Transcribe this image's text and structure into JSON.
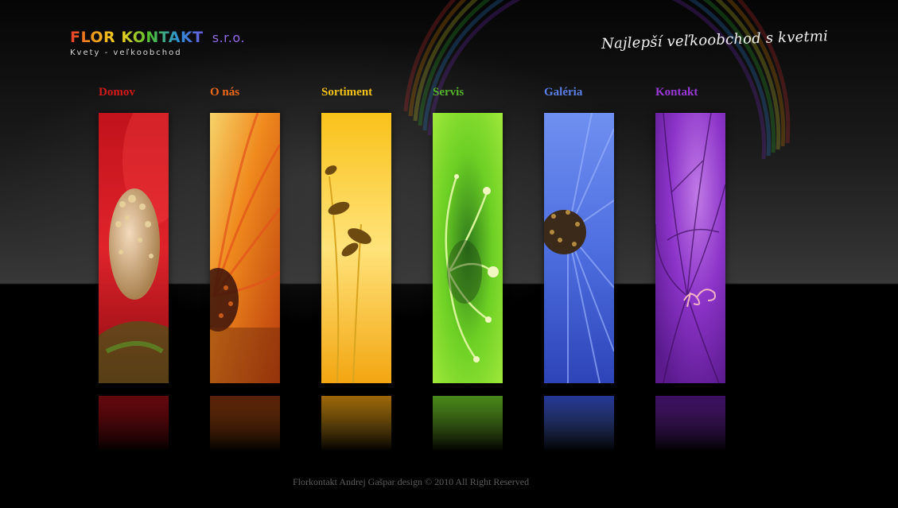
{
  "logo": {
    "part1": "FLOR",
    "part2": "KONTAKT",
    "suffix": "s.r.o.",
    "subtitle": "Kvety - veľkoobchod"
  },
  "tagline": "Najlepší veľkoobchod s kvetmi",
  "nav": {
    "items": [
      {
        "label": "Domov",
        "color": "#d21a1a"
      },
      {
        "label": "O nás",
        "color": "#ee6a1b"
      },
      {
        "label": "Sortiment",
        "color": "#f2c21b"
      },
      {
        "label": "Servis",
        "color": "#56b32d"
      },
      {
        "label": "Galéria",
        "color": "#5b7fe6"
      },
      {
        "label": "Kontakt",
        "color": "#9a3ad6"
      }
    ]
  },
  "panels": [
    {
      "flower": "red-flower-image"
    },
    {
      "flower": "orange-flower-image"
    },
    {
      "flower": "yellow-flower-image"
    },
    {
      "flower": "green-flower-image"
    },
    {
      "flower": "blue-flower-image"
    },
    {
      "flower": "purple-flower-image"
    }
  ],
  "footer": "Florkontakt Andrej Gašpar design © 2010 All Right Reserved"
}
